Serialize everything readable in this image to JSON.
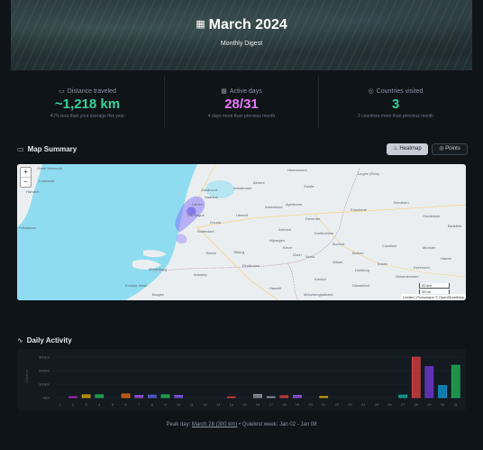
{
  "hero": {
    "title": "March 2024",
    "subtitle": "Monthly Digest"
  },
  "stats": [
    {
      "label": "Distance traveled",
      "value": "~1,218 km",
      "sub": "41% less than your average this year",
      "color": "#34d399"
    },
    {
      "label": "Active days",
      "value": "28/31",
      "sub": "4 days more than previous month",
      "color": "#e879f9"
    },
    {
      "label": "Countries visited",
      "value": "3",
      "sub": "2 countries more than previous month",
      "color": "#34d399"
    }
  ],
  "map_section": {
    "title": "Map Summary",
    "heatmap_label": "Heatmap",
    "points_label": "Points",
    "zoom_in": "+",
    "zoom_out": "−",
    "scale": [
      "20 km",
      "20 mi"
    ],
    "attribution": "Leaflet | Protomaps © OpenStreetMap",
    "places": [
      "Great Yarmouth",
      "Lowestoft",
      "Felixstowe",
      "Harwich",
      "Zandvoort",
      "Amsterdam",
      "Haarlem",
      "The Hague",
      "Rotterdam",
      "Utrecht",
      "Amersfoort",
      "Apeldoorn",
      "Zwolle",
      "Enschede",
      "Arnhem",
      "Nijmegen",
      "Eindhoven",
      "Tilburg",
      "Breda",
      "Antwerp",
      "Middelburg",
      "Knokke-Heist",
      "Bruges",
      "Hasselt",
      "Venlo",
      "Münster",
      "Dortmund",
      "Essen",
      "Duisburg",
      "Düsseldorf",
      "Lingen (Ems)",
      "Osnabrück",
      "Bielefeld",
      "Hamm",
      "Krefeld",
      "Mönchengladbach",
      "Bocholt",
      "Coesfeld",
      "Borken",
      "Gouda",
      "Leiden",
      "Almere",
      "Nordhorn",
      "Heerenveen",
      "Deventer",
      "Doetinchem",
      "Goch",
      "Kleve",
      "Gelsenkirchen",
      "Wesel"
    ]
  },
  "activity_section": {
    "title": "Daily Activity",
    "footer_prefix": "Peak day:",
    "peak_day": "March 28 (300 km)",
    "separator": "•",
    "quietest": "Quietest week: Jan 02 - Jan 08"
  },
  "chart_data": {
    "type": "bar",
    "categories": [
      "1",
      "2",
      "3",
      "4",
      "5",
      "6",
      "7",
      "8",
      "9",
      "10",
      "11",
      "12",
      "13",
      "14",
      "15",
      "16",
      "17",
      "18",
      "19",
      "20",
      "21",
      "22",
      "23",
      "24",
      "25",
      "26",
      "27",
      "28",
      "29",
      "30",
      "31"
    ],
    "values": [
      0,
      8,
      22,
      22,
      0,
      28,
      18,
      20,
      22,
      18,
      0,
      0,
      0,
      6,
      0,
      25,
      8,
      15,
      18,
      0,
      10,
      0,
      0,
      0,
      0,
      0,
      20,
      300,
      230,
      90,
      240
    ],
    "colors": [
      "#3b82f6",
      "#c026d3",
      "#eab308",
      "#22c55e",
      "#3b82f6",
      "#f97316",
      "#a855f7",
      "#6366f1",
      "#22c55e",
      "#8b5cf6",
      "#3b82f6",
      "#3b82f6",
      "#3b82f6",
      "#ef4444",
      "#3b82f6",
      "#9ca3af",
      "#9ca3af",
      "#ef4444",
      "#a855f7",
      "#3b82f6",
      "#eab308",
      "#3b82f6",
      "#3b82f6",
      "#3b82f6",
      "#3b82f6",
      "#3b82f6",
      "#14b8a6",
      "#ef4444",
      "#7c3aed",
      "#0ea5e9",
      "#22c55e"
    ],
    "yticks": [
      "0km",
      "100km",
      "200km",
      "300km"
    ],
    "ylabel": "Distance",
    "ylim": [
      0,
      320
    ],
    "grid": true
  }
}
